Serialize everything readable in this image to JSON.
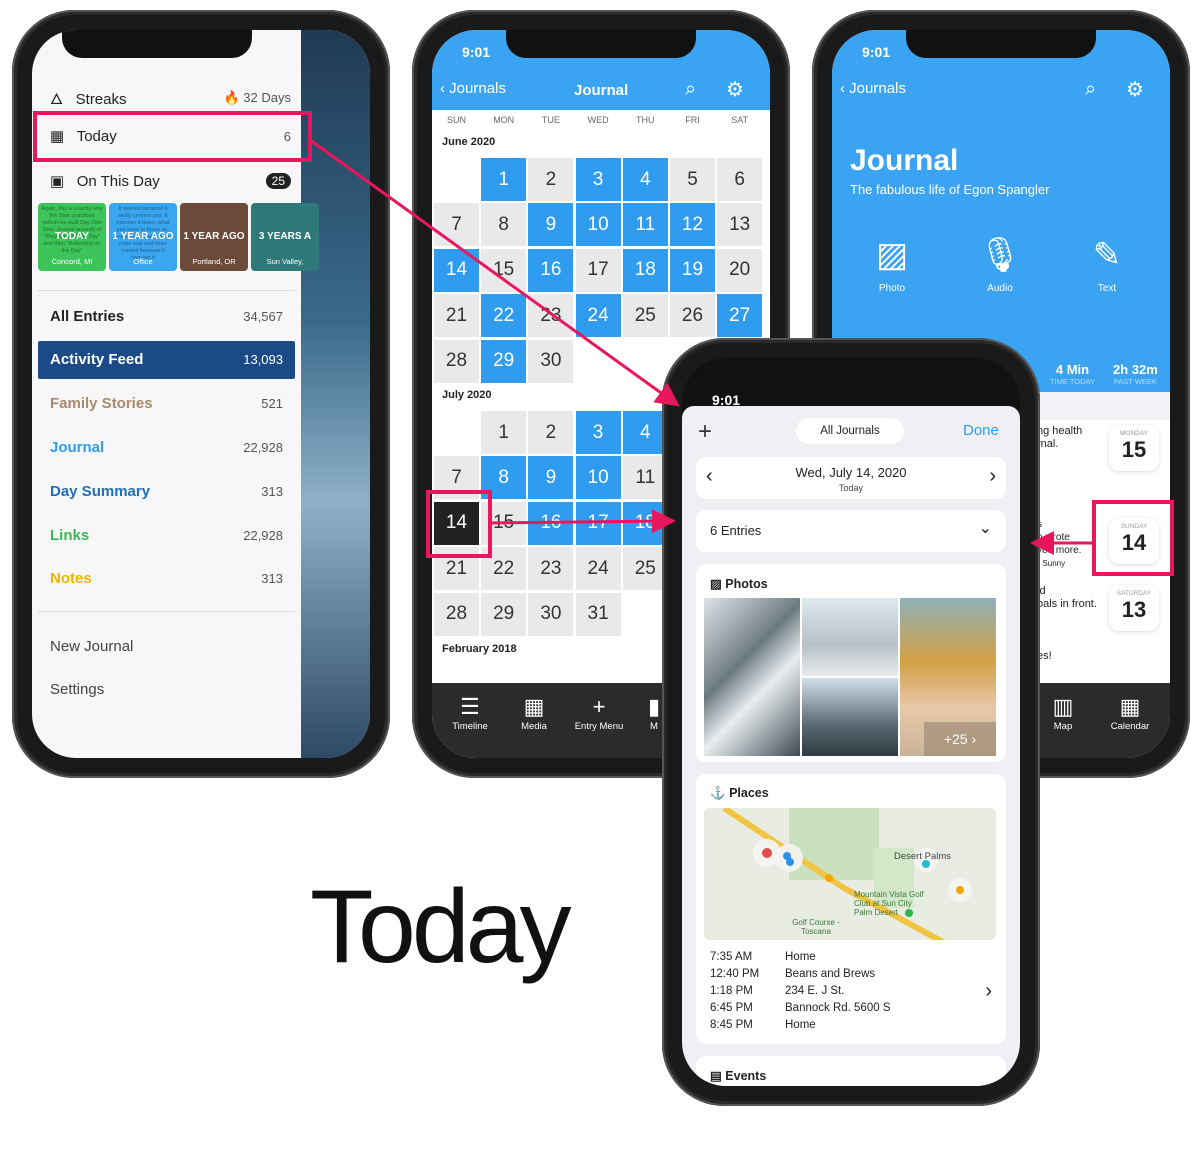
{
  "headline": "Today",
  "accent": "#e8175d",
  "sidebar": {
    "streaks": {
      "label": "Streaks",
      "value": "32 Days"
    },
    "today": {
      "label": "Today",
      "count": "6"
    },
    "on_this_day": {
      "label": "On This Day",
      "count": "25"
    },
    "memories": [
      {
        "label": "TODAY",
        "place": "Concord, MI",
        "text": "Again, this is exactly why the Stoic practices (which we built Day One Stoic Journal around) of \"Preparing for the Day\" and then \"Reflecting on the Day\"",
        "color": "#3cc35a"
      },
      {
        "label": "1 YEAR AGO",
        "place": "Office",
        "text": "It worked because it really centers you. It narrows it down, what you have to focus on, your goal. It becomes more real and more current because it narrows it",
        "color": "#3aa6f0"
      },
      {
        "label": "1 YEAR AGO",
        "place": "Portland, OR",
        "color": "#6b4a3a"
      },
      {
        "label": "3 YEARS A",
        "place": "Sun Valley,",
        "color": "#2f7a78"
      }
    ],
    "journals": [
      {
        "label": "All Entries",
        "count": "34,567",
        "color": "#222"
      },
      {
        "label": "Activity Feed",
        "count": "13,093",
        "color": "#ffffff",
        "selected": true
      },
      {
        "label": "Family Stories",
        "count": "521",
        "color": "#a88a6a"
      },
      {
        "label": "Journal",
        "count": "22,928",
        "color": "#2f9cf0"
      },
      {
        "label": "Day Summary",
        "count": "313",
        "color": "#1f6fb8"
      },
      {
        "label": "Links",
        "count": "22,928",
        "color": "#3cb85a"
      },
      {
        "label": "Notes",
        "count": "313",
        "color": "#f0b400"
      }
    ],
    "footer": [
      "New Journal",
      "Settings"
    ]
  },
  "calendar": {
    "time": "9:01",
    "back": "Journals",
    "title": "Journal",
    "weekdays": [
      "SUN",
      "MON",
      "TUE",
      "WED",
      "THU",
      "FRI",
      "SAT"
    ],
    "months": [
      {
        "label": "June 2020",
        "start": 1,
        "days": 30,
        "blue": [
          1,
          3,
          4,
          9,
          10,
          11,
          12,
          14,
          16,
          18,
          19,
          22,
          24,
          27,
          29
        ]
      },
      {
        "label": "July 2020",
        "start": 1,
        "days": 31,
        "blue": [
          3,
          4,
          8,
          9,
          10,
          16,
          17,
          18
        ],
        "selected": 14
      }
    ],
    "next_month": "February 2018",
    "tabs": [
      "Timeline",
      "Media",
      "Entry Menu",
      "M"
    ]
  },
  "journal_home": {
    "time": "9:01",
    "back": "Journals",
    "title": "Journal",
    "subtitle": "The fabulous life of Egon Spangler",
    "actions": [
      "Photo",
      "Audio",
      "Text"
    ],
    "stats": [
      {
        "value": "4 Min",
        "label": "TIME TODAY"
      },
      {
        "value": "2h 32m",
        "label": "PAST WEEK"
      }
    ],
    "entries": [
      {
        "snippet": [
          "ng health",
          "rnal."
        ],
        "weekday": "MONDAY",
        "day": "15"
      },
      {
        "snippet": [
          "s",
          "o wrote",
          "ved more.",
          "° Sunny"
        ],
        "weekday": "SUNDAY",
        "day": "14"
      },
      {
        "snippet": [
          "id",
          "oals in front."
        ],
        "weekday": "SATURDAY",
        "day": "13"
      },
      {
        "snippet": [
          "es!"
        ]
      }
    ],
    "tabs": [
      "Map",
      "Calendar"
    ]
  },
  "today_view": {
    "time": "9:01",
    "filter": "All Journals",
    "done": "Done",
    "date": "Wed, July 14, 2020",
    "date_sub": "Today",
    "entries": "6 Entries",
    "photos_title": "Photos",
    "photos_more": "+25",
    "places_title": "Places",
    "map_labels": [
      "Desert Palms",
      "Mountain Vista Golf Club at Sun City Palm Desert",
      "Golf Course - Toscana"
    ],
    "places": [
      {
        "time": "7:35 AM",
        "name": "Home"
      },
      {
        "time": "12:40 PM",
        "name": "Beans and Brews"
      },
      {
        "time": "1:18 PM",
        "name": "234 E. J St."
      },
      {
        "time": "6:45 PM",
        "name": "Bannock Rd. 5600 S"
      },
      {
        "time": "8:45 PM",
        "name": "Home"
      }
    ],
    "events_title": "Events"
  }
}
